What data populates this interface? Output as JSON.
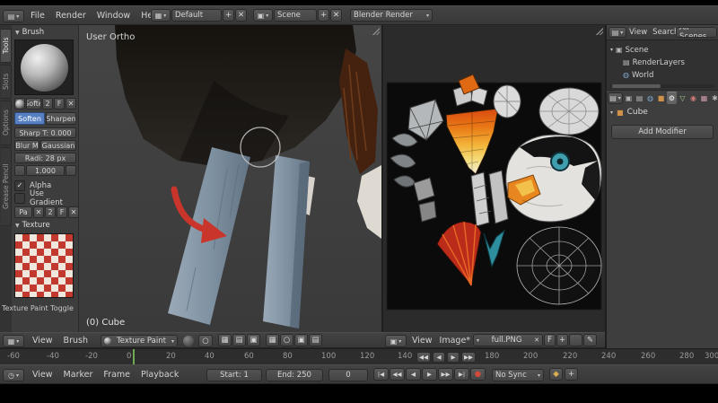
{
  "topbar": {
    "menus": [
      "File",
      "Render",
      "Window",
      "Help"
    ],
    "layout_value": "Default",
    "scene_value": "Scene",
    "engine_value": "Blender Render"
  },
  "toolshelf": {
    "tabs": [
      "Tools",
      "Slots",
      "Options",
      "Grease Pencil"
    ],
    "brush": {
      "panel_title": "Brush",
      "name_short": "Softe",
      "users_count": "2",
      "fake_user": "F",
      "soften_label": "Soften",
      "sharpen_label": "Sharpen",
      "sharp_threshold": "Sharp T: 0.000",
      "blur_label": "Blur M",
      "blur_value": "Gaussian",
      "radius": "Radi: 28 px",
      "strength": "1.000",
      "alpha": "Alpha",
      "use_gradient": "Use Gradient",
      "palette_short": "Pa",
      "palette_users": "2",
      "palette_fake": "F"
    },
    "texture_title": "Texture",
    "bottom_toggle": "Texture Paint Toggle"
  },
  "viewport": {
    "view_label": "User Ortho",
    "object_label": "(0) Cube",
    "header_menus": [
      "View",
      "Brush"
    ],
    "mode": "Texture Paint"
  },
  "uv_editor": {
    "header_menus": [
      "View",
      "Image*"
    ],
    "image_name": "full.PNG",
    "fake_user_label": "F"
  },
  "outliner": {
    "header_menus": [
      "View",
      "Search"
    ],
    "display_mode": "All Scenes",
    "tree": [
      "Scene",
      "RenderLayers",
      "World"
    ]
  },
  "properties": {
    "tab_glyphs": [
      "▣",
      "▤",
      "◍",
      "■",
      "⚙",
      "▽",
      "◉",
      "▦",
      "✱",
      "○"
    ],
    "object_icon": "■",
    "object_name": "Cube",
    "add_modifier": "Add Modifier"
  },
  "timeline": {
    "menus": [
      "View",
      "Marker",
      "Frame",
      "Playback"
    ],
    "start": "Start: 1",
    "end": "End: 250",
    "current_frame": "0",
    "sync_mode": "No Sync",
    "ruler": [
      "-60",
      "-40",
      "-20",
      "0",
      "20",
      "40",
      "60",
      "80",
      "100",
      "120",
      "140",
      "180",
      "200",
      "220",
      "240",
      "260",
      "280",
      "300"
    ]
  },
  "glyphs": {
    "dropdown": "▾",
    "close": "✕",
    "plus": "+",
    "check": "✓",
    "panel": "▼",
    "circle": "○",
    "grid": "▦",
    "image": "▣",
    "info": "▤",
    "clock": "◷",
    "jump_start": "|◀",
    "rew": "◀◀",
    "prev": "◀",
    "play": "▶",
    "fwd": "▶▶",
    "jump_end": "▶|",
    "record": "●",
    "key": "◆",
    "pencil": "✎",
    "world": "◍",
    "scene": "▣",
    "layers": "▤"
  },
  "colors": {
    "accent": "#5680c2",
    "playhead": "#6faa53",
    "arrow": "#c9352b"
  }
}
